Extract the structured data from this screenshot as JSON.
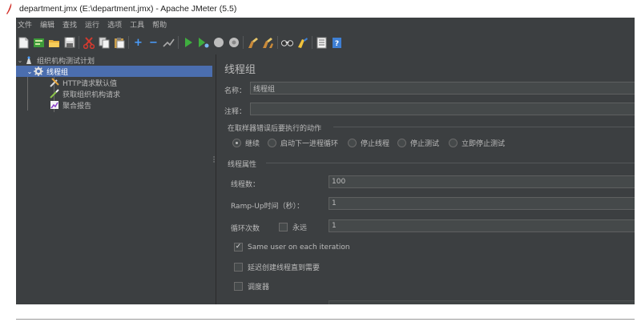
{
  "window": {
    "title": "department.jmx (E:\\department.jmx) - Apache JMeter (5.5)"
  },
  "menubar": {
    "items": [
      "文件",
      "编辑",
      "查找",
      "运行",
      "选项",
      "工具",
      "帮助"
    ]
  },
  "toolbar": {
    "icons": [
      "new-icon",
      "templates-icon",
      "open-icon",
      "save-icon",
      "cut-icon",
      "copy-icon",
      "paste-icon",
      "expand-icon",
      "collapse-icon",
      "toggle-icon",
      "start-icon",
      "start-no-pause-icon",
      "stop-icon",
      "shutdown-icon",
      "clear-icon",
      "clear-all-icon",
      "search-icon",
      "reset-search-icon",
      "function-helper-icon",
      "help-icon"
    ]
  },
  "tree": {
    "root": "组织机构测试计划",
    "thread_group": "线程组",
    "children": [
      "HTTP请求默认值",
      "获取组织机构请求",
      "聚合报告"
    ]
  },
  "panel": {
    "title": "线程组",
    "name_label": "名称：",
    "name_value": "线程组",
    "comment_label": "注释：",
    "comment_value": "",
    "error_action_title": "在取样器错误后要执行的动作",
    "error_actions": [
      {
        "label": "继续",
        "selected": true
      },
      {
        "label": "启动下一进程循环",
        "selected": false
      },
      {
        "label": "停止线程",
        "selected": false
      },
      {
        "label": "停止测试",
        "selected": false
      },
      {
        "label": "立即停止测试",
        "selected": false
      }
    ],
    "thread_props_title": "线程属性",
    "threads_label": "线程数：",
    "threads_value": "100",
    "rampup_label": "Ramp-Up时间（秒）：",
    "rampup_value": "1",
    "loop_label": "循环次数",
    "forever_label": "永远",
    "forever_checked": false,
    "loop_value": "1",
    "same_user_label": "Same user on each iteration",
    "same_user_checked": true,
    "delay_label": "延迟创建线程直到需要",
    "delay_checked": false,
    "scheduler_label": "调度器",
    "scheduler_checked": false
  }
}
